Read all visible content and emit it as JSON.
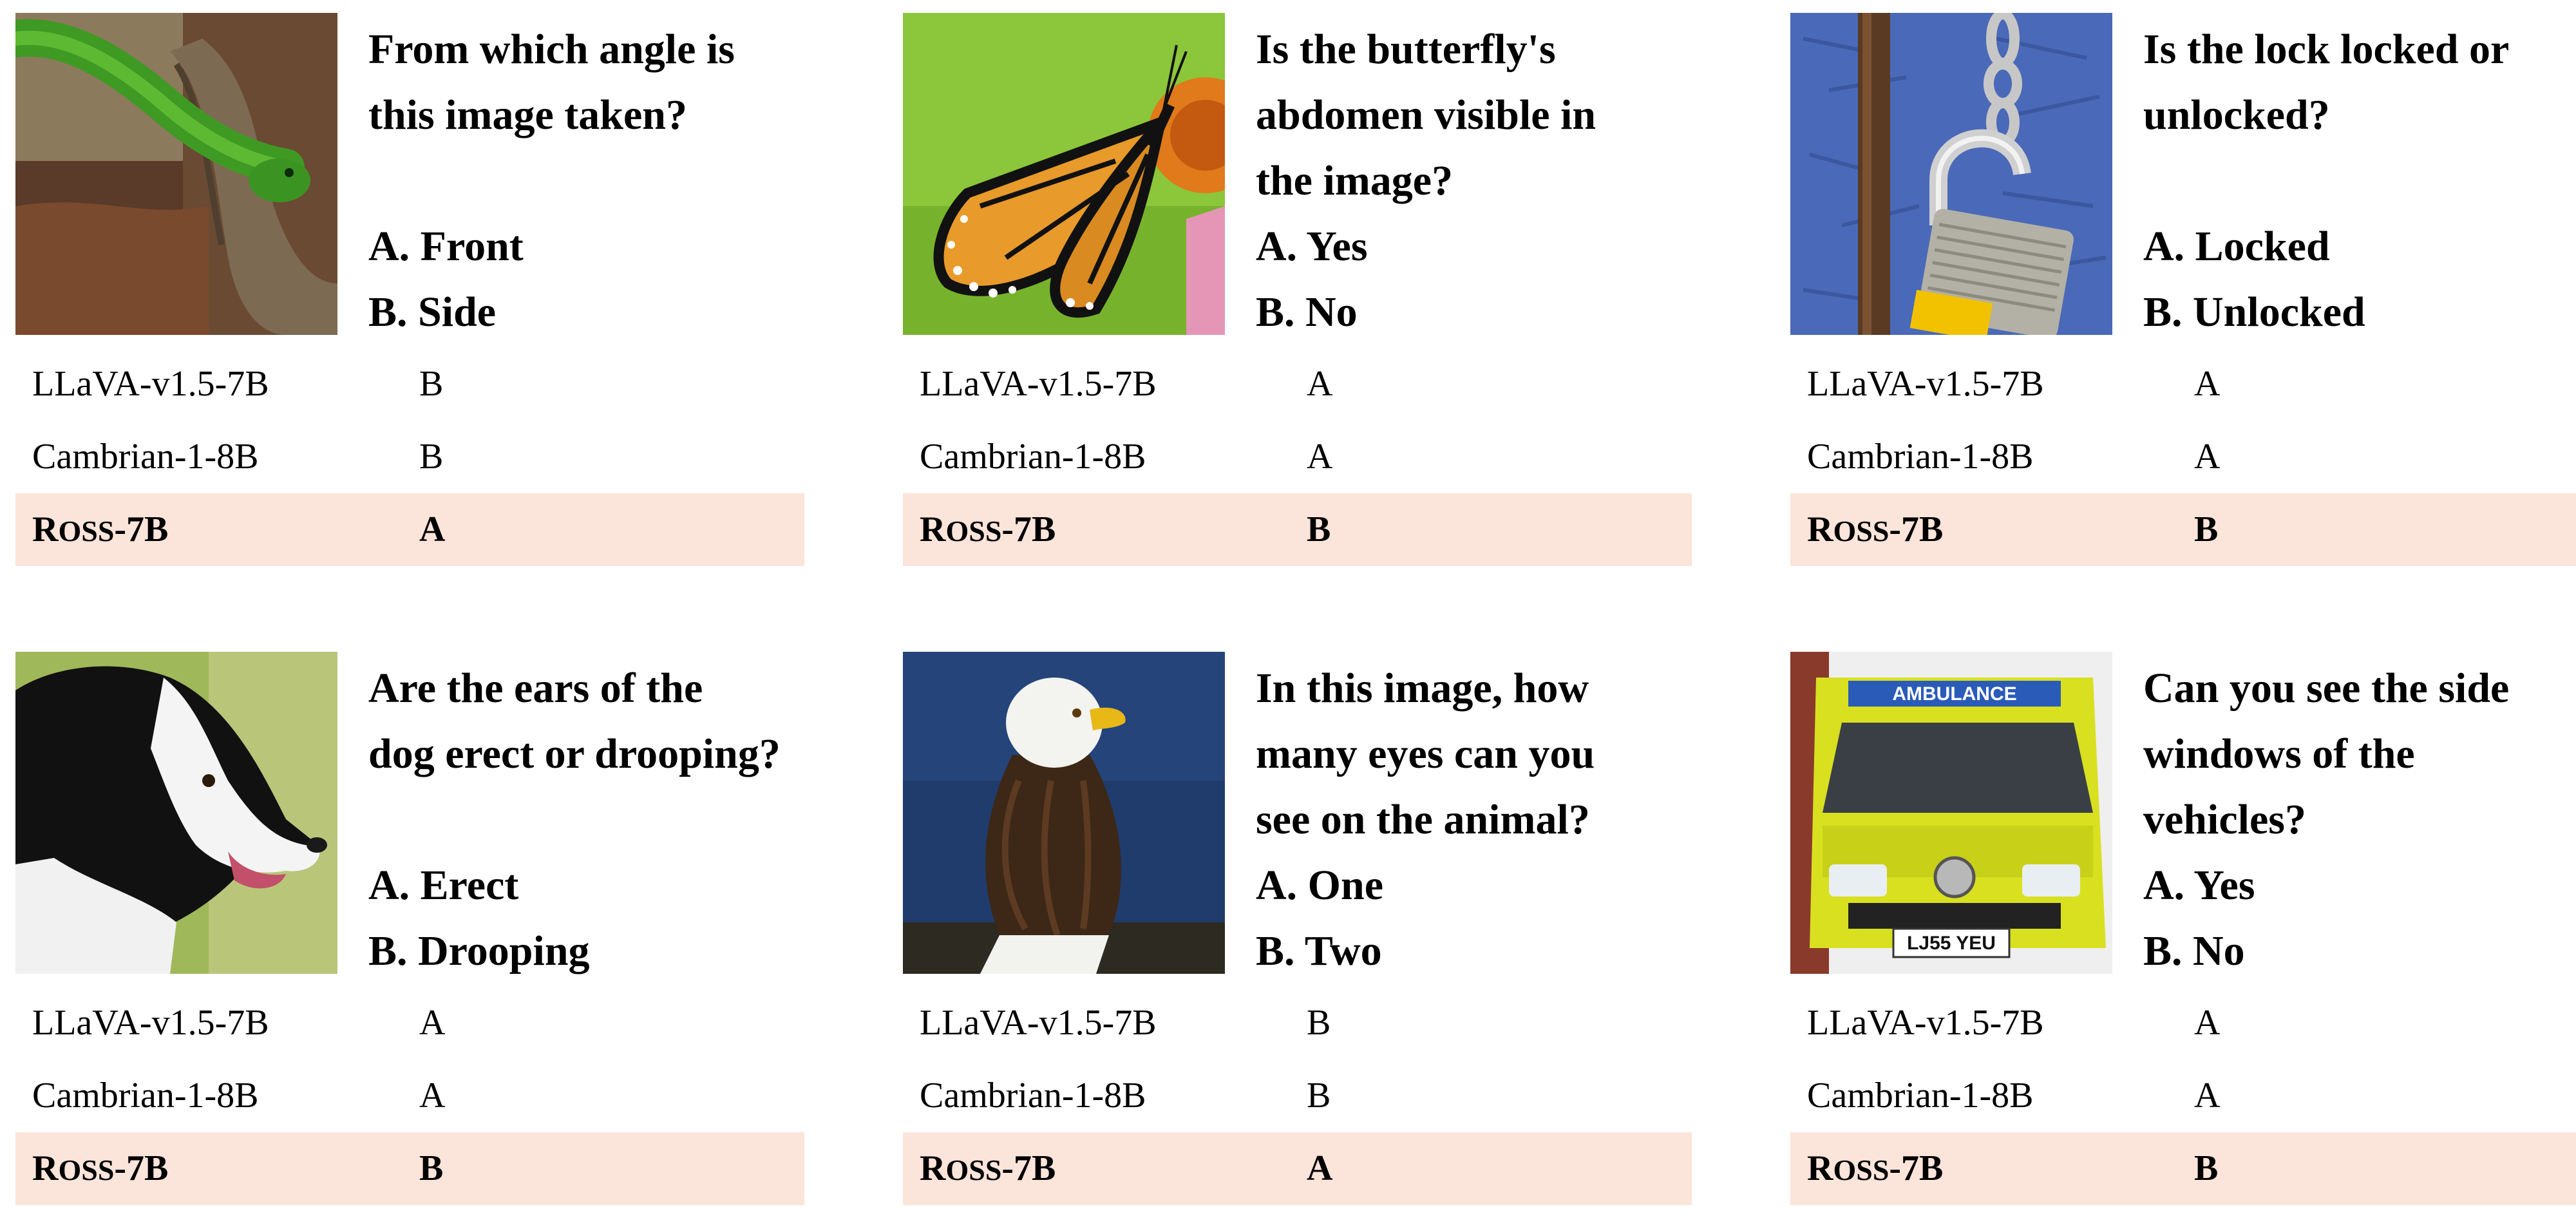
{
  "highlight_color": "#fbe4da",
  "panels": [
    {
      "image_subject": "green snake on a branch",
      "question_lines": [
        "From which angle is",
        "this image taken?"
      ],
      "blank_line_before_options": true,
      "options": [
        "A. Front",
        "B. Side"
      ],
      "rows": [
        {
          "model": "LLaVA-v1.5-7B",
          "answer": "B"
        },
        {
          "model": "Cambrian-1-8B",
          "answer": "B"
        },
        {
          "model_first": "R",
          "model_rest": "OSS",
          "model_suffix": "-7B",
          "answer": "A"
        }
      ]
    },
    {
      "image_subject": "monarch butterfly on a flower",
      "question_lines": [
        "Is the butterfly's",
        "abdomen visible in",
        "the image?"
      ],
      "blank_line_before_options": false,
      "options": [
        "A. Yes",
        "B. No"
      ],
      "rows": [
        {
          "model": "LLaVA-v1.5-7B",
          "answer": "A"
        },
        {
          "model": "Cambrian-1-8B",
          "answer": "A"
        },
        {
          "model_first": "R",
          "model_rest": "OSS",
          "model_suffix": "-7B",
          "answer": "B"
        }
      ]
    },
    {
      "image_subject": "padlock on a chain",
      "question_lines": [
        "Is the lock locked or",
        "unlocked?"
      ],
      "blank_line_before_options": true,
      "options": [
        "A. Locked",
        "B. Unlocked"
      ],
      "rows": [
        {
          "model": "LLaVA-v1.5-7B",
          "answer": "A"
        },
        {
          "model": "Cambrian-1-8B",
          "answer": "A"
        },
        {
          "model_first": "R",
          "model_rest": "OSS",
          "model_suffix": "-7B",
          "answer": "B"
        }
      ]
    },
    {
      "image_subject": "black and white dog",
      "question_lines": [
        "Are the ears of the",
        "dog erect or drooping?"
      ],
      "blank_line_before_options": true,
      "options": [
        "A. Erect",
        "B. Drooping"
      ],
      "rows": [
        {
          "model": "LLaVA-v1.5-7B",
          "answer": "A"
        },
        {
          "model": "Cambrian-1-8B",
          "answer": "A"
        },
        {
          "model_first": "R",
          "model_rest": "OSS",
          "model_suffix": "-7B",
          "answer": "B"
        }
      ]
    },
    {
      "image_subject": "bald eagle",
      "question_lines": [
        "In this image, how",
        "many eyes can you",
        "see on the animal?"
      ],
      "blank_line_before_options": false,
      "options": [
        "A. One",
        "B. Two"
      ],
      "rows": [
        {
          "model": "LLaVA-v1.5-7B",
          "answer": "B"
        },
        {
          "model": "Cambrian-1-8B",
          "answer": "B"
        },
        {
          "model_first": "R",
          "model_rest": "OSS",
          "model_suffix": "-7B",
          "answer": "A"
        }
      ]
    },
    {
      "image_subject": "yellow ambulance",
      "ambulance_text": "AMBULANCE",
      "plate_text": "LJ55 YEU",
      "question_lines": [
        "Can you see the side",
        "windows of the",
        "vehicles?"
      ],
      "blank_line_before_options": false,
      "options": [
        "A. Yes",
        "B. No"
      ],
      "rows": [
        {
          "model": "LLaVA-v1.5-7B",
          "answer": "A"
        },
        {
          "model": "Cambrian-1-8B",
          "answer": "A"
        },
        {
          "model_first": "R",
          "model_rest": "OSS",
          "model_suffix": "-7B",
          "answer": "B"
        }
      ]
    }
  ]
}
